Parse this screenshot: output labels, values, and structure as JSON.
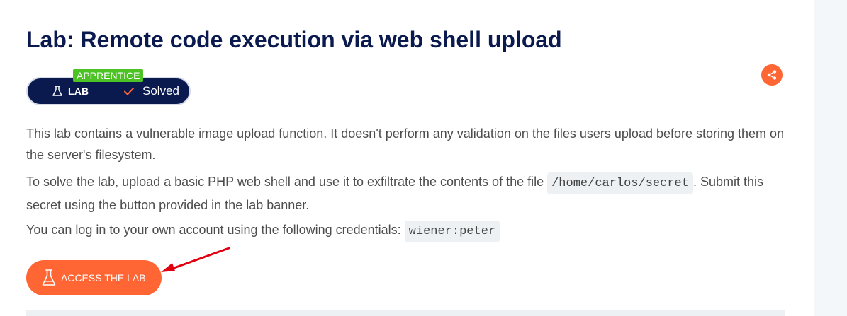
{
  "lab": {
    "title": "Lab: Remote code execution via web shell upload",
    "level": "APPRENTICE",
    "type_label": "LAB",
    "status": "Solved"
  },
  "description": {
    "p1": "This lab contains a vulnerable image upload function. It doesn't perform any validation on the files users upload before storing them on the server's filesystem.",
    "p2_before": "To solve the lab, upload a basic PHP web shell and use it to exfiltrate the contents of the file ",
    "p2_code": "/home/carlos/secret",
    "p2_after": ". Submit this secret using the button provided in the lab banner.",
    "p3_before": "You can log in to your own account using the following credentials: ",
    "p3_code": "wiener:peter"
  },
  "actions": {
    "access_label": "ACCESS THE LAB"
  },
  "icons": {
    "share": "share-icon",
    "flask": "flask-icon",
    "check": "check-icon"
  },
  "colors": {
    "navy": "#0a1a4f",
    "orange": "#ff6633",
    "green": "#4cc224",
    "annotation_red": "#e0000f"
  }
}
